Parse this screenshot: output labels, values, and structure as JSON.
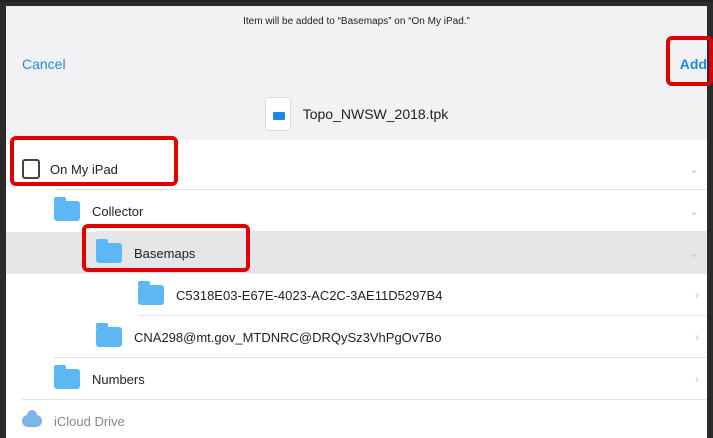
{
  "header": {
    "banner": "Item will be added to “Basemaps” on “On My iPad.”",
    "cancel_label": "Cancel",
    "add_label": "Add",
    "file_name": "Topo_NWSW_2018.tpk"
  },
  "tree": {
    "root": "On My iPad",
    "collector": "Collector",
    "basemaps": "Basemaps",
    "basemaps_child": "C5318E03-E67E-4023-AC2C-3AE11D5297B4",
    "cna": "CNA298@mt.gov_MTDNRC@DRQySz3VhPgOv7Bo",
    "numbers": "Numbers",
    "icloud": "iCloud Drive"
  },
  "colors": {
    "accent": "#1e88e5",
    "highlight": "#e00000",
    "folder": "#5db7f4"
  }
}
